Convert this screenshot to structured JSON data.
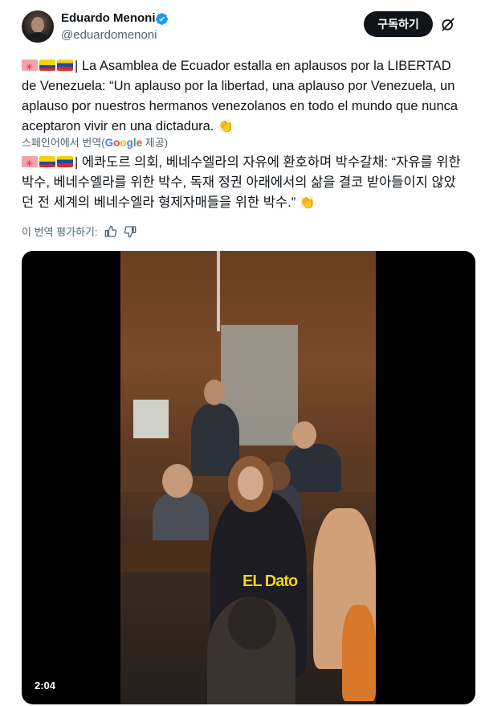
{
  "author": {
    "name": "Eduardo Menoni",
    "handle": "@eduardomenoni",
    "verified": true
  },
  "header": {
    "subscribe_label": "구독하기",
    "grok_icon": "grok-icon"
  },
  "tweet": {
    "original_text": "| La Asamblea de Ecuador estalla en aplausos por la LIBERTAD de Venezuela: “Un aplauso por la libertad, una aplauso por Venezuela, un aplauso por nuestros hermanos venezolanos en todo el mundo que nunca aceptaron vivir en una dictadura.",
    "translated_by_prefix": "스페인어에서 번역(",
    "translated_by_suffix": " 제공)",
    "translated_text": "| 에콰도르 의회, 베네수엘라의 자유에 환호하며 박수갈채: “자유를 위한 박수, 베네수엘라를 위한 박수, 독재 정권 아래에서의 삶을 결코 받아들이지 않았던 전 세계의 베네수엘라 형제자매들을 위한 박수.”",
    "rate_translation_label": "이 번역 평가하기:"
  },
  "google_logo": [
    "G",
    "o",
    "o",
    "g",
    "l",
    "e"
  ],
  "video": {
    "duration": "2:04",
    "watermark_text": "EL Dato"
  },
  "colors": {
    "text_primary": "#0f1419",
    "text_secondary": "#536471",
    "verified_blue": "#1d9bf0",
    "brand_yellow": "#f2d90c"
  }
}
